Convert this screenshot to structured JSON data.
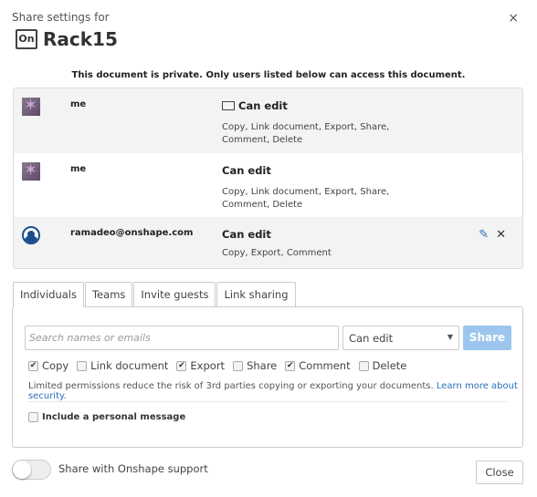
{
  "header": {
    "subtitle": "Share settings for",
    "doc_name": "Rack15",
    "doc_icon_text": "On",
    "close_icon": "×"
  },
  "privacy_note": "This document is private. Only users listed below can access this document.",
  "users": [
    {
      "name": "me",
      "permission": "Can edit",
      "permissions_list": "Copy, Link document, Export, Share, Comment, Delete",
      "icon": "folder-icon"
    },
    {
      "name": "me",
      "permission": "Can edit",
      "permissions_list": "Copy, Link document, Export, Share, Comment, Delete"
    },
    {
      "name": "ramadeo@onshape.com",
      "permission": "Can edit",
      "permissions_list": "Copy, Export, Comment",
      "edit_icon": "✎",
      "remove_icon": "✕"
    }
  ],
  "tabs": [
    "Individuals",
    "Teams",
    "Invite guests",
    "Link sharing"
  ],
  "search": {
    "placeholder": "Search names or emails"
  },
  "permission_select": {
    "value": "Can edit",
    "arrow": "▼"
  },
  "share_label": "Share",
  "checkboxes": [
    {
      "label": "Copy",
      "checked": true
    },
    {
      "label": "Link document",
      "checked": false
    },
    {
      "label": "Export",
      "checked": true
    },
    {
      "label": "Share",
      "checked": false
    },
    {
      "label": "Comment",
      "checked": true
    },
    {
      "label": "Delete",
      "checked": false
    }
  ],
  "note": "Limited permissions reduce the risk of 3rd parties copying or exporting your documents.",
  "learn_more": "Learn more about security.",
  "personal_message": "Include a personal message",
  "support_toggle": {
    "label": "Share with Onshape support",
    "on": false
  },
  "close_label": "Close"
}
